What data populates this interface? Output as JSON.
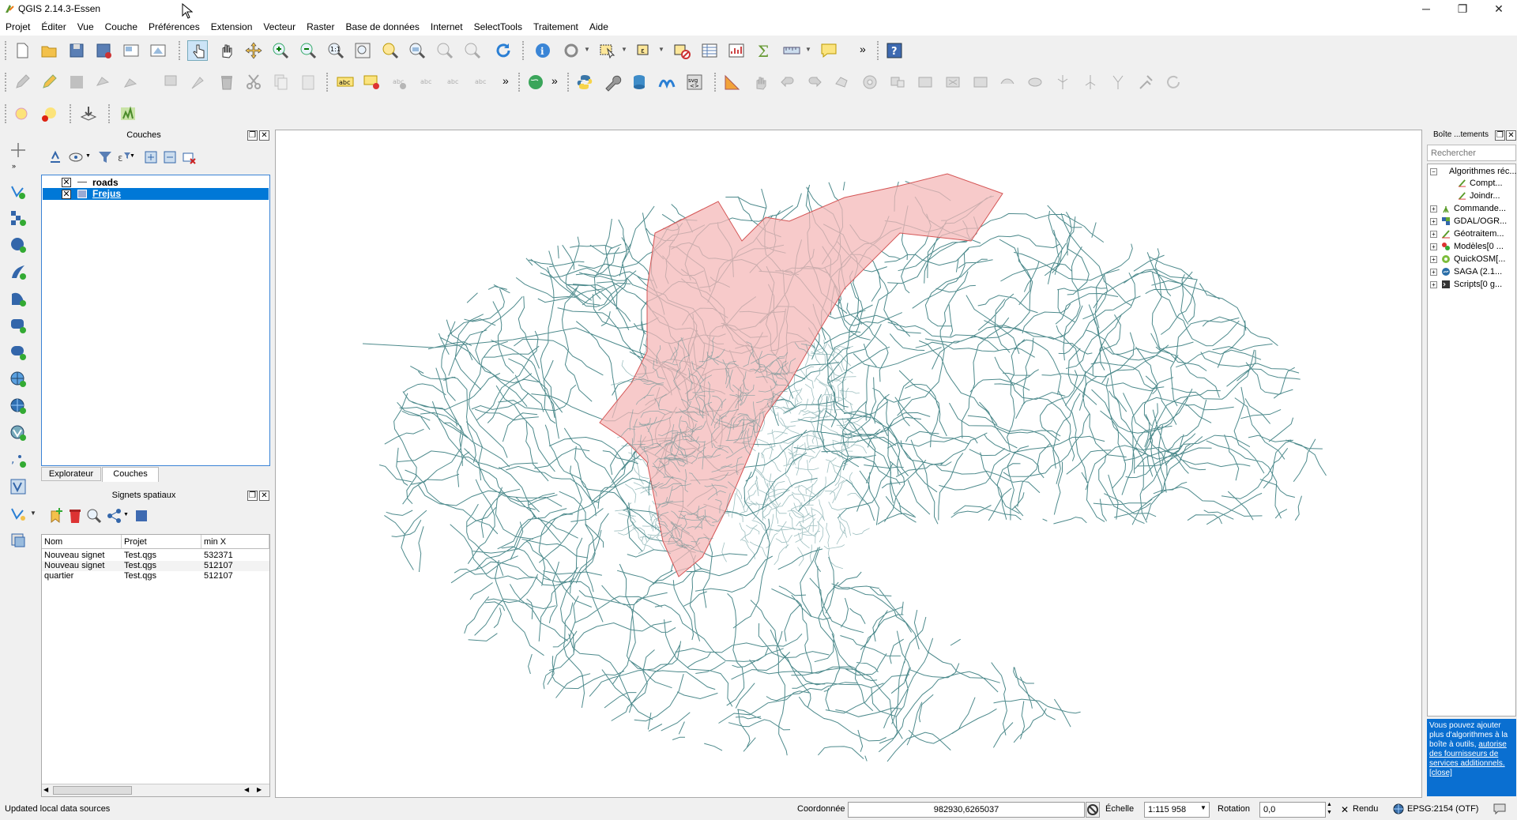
{
  "window": {
    "title": "QGIS 2.14.3-Essen",
    "minimize": "─",
    "maximize": "❐",
    "close": "✕"
  },
  "menu": [
    "Projet",
    "Éditer",
    "Vue",
    "Couche",
    "Préférences",
    "Extension",
    "Vecteur",
    "Raster",
    "Base de données",
    "Internet",
    "SelectTools",
    "Traitement",
    "Aide"
  ],
  "toolbar": {
    "overflow": "»"
  },
  "layers_panel": {
    "title": "Couches",
    "float_btn": "❐",
    "close_btn": "✕",
    "layers": [
      {
        "name": "roads",
        "checked": "✕",
        "selected": false
      },
      {
        "name": "Frejus",
        "checked": "✕",
        "selected": true
      }
    ],
    "tabs": [
      "Explorateur",
      "Couches"
    ]
  },
  "bookmarks_panel": {
    "title": "Signets spatiaux",
    "columns": [
      "Nom",
      "Projet",
      "min X"
    ],
    "rows": [
      [
        "Nouveau signet",
        "Test.qgs",
        "532371"
      ],
      [
        "Nouveau signet",
        "Test.qgs",
        "512107"
      ],
      [
        "quartier",
        "Test.qgs",
        "512107"
      ]
    ]
  },
  "toolbox_panel": {
    "title": "Boîte ...tements",
    "search_placeholder": "Rechercher",
    "items": [
      {
        "label": "Algorithmes réc...",
        "level": 0,
        "expander": "−"
      },
      {
        "label": "Compt...",
        "level": 1,
        "expander": ""
      },
      {
        "label": "Joindr...",
        "level": 1,
        "expander": ""
      },
      {
        "label": "Commande...",
        "level": 0,
        "expander": "+"
      },
      {
        "label": "GDAL/OGR...",
        "level": 0,
        "expander": "+"
      },
      {
        "label": "Géotraitem...",
        "level": 0,
        "expander": "+"
      },
      {
        "label": "Modèles[0 ...",
        "level": 0,
        "expander": "+"
      },
      {
        "label": "QuickOSM[...",
        "level": 0,
        "expander": "+"
      },
      {
        "label": "SAGA (2.1...",
        "level": 0,
        "expander": "+"
      },
      {
        "label": "Scripts[0 g...",
        "level": 0,
        "expander": "+"
      }
    ],
    "notice_text": "Vous pouvez ajouter plus d'algorithmes à la boîte à outils,",
    "notice_link": "autorise des fournisseurs de services additionnels.",
    "notice_close": "[close]"
  },
  "statusbar": {
    "message": "Updated local data sources",
    "coord_label": "Coordonnée",
    "coord_value": "982930,6265037",
    "scale_label": "Échelle",
    "scale_value": "1:115 958",
    "rotation_label": "Rotation",
    "rotation_value": "0,0",
    "render_label": "Rendu",
    "render_check": "✕",
    "crs": "EPSG:2154 (OTF)"
  },
  "colors": {
    "road": "#4d8a8c",
    "polygon_fill": "#f4b8b8",
    "polygon_stroke": "#d45555",
    "selection": "#0078d7",
    "notice_bg": "#0a6fd1"
  }
}
